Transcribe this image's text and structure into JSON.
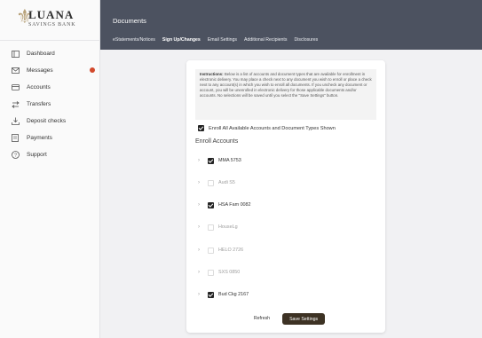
{
  "brand": {
    "name": "LUANA",
    "subtitle": "SAVINGS BANK"
  },
  "sidebar": {
    "items": [
      {
        "label": "Dashboard",
        "icon": "dashboard-icon"
      },
      {
        "label": "Messages",
        "icon": "mail-icon",
        "badge": true
      },
      {
        "label": "Accounts",
        "icon": "card-icon"
      },
      {
        "label": "Transfers",
        "icon": "transfer-icon"
      },
      {
        "label": "Deposit checks",
        "icon": "deposit-icon"
      },
      {
        "label": "Payments",
        "icon": "bill-icon"
      },
      {
        "label": "Support",
        "icon": "support-icon"
      }
    ]
  },
  "header": {
    "title": "Documents",
    "tabs": [
      {
        "label": "eStatements/Notices",
        "active": false
      },
      {
        "label": "Sign Up/Changes",
        "active": true
      },
      {
        "label": "Email Settings",
        "active": false
      },
      {
        "label": "Additional Recipients",
        "active": false
      },
      {
        "label": "Disclosures",
        "active": false
      }
    ]
  },
  "instructions": {
    "heading": "Instructions:",
    "text": "Below is a list of accounts and document types that are available for enrollment in electronic delivery. You may place a check next to any document you wish to enroll or place a check next to any account(s) in which you wish to enroll all documents. If you uncheck any document or account, you will be unenrolled in electronic delivery for those applicable documents and/or accounts. No selections will be saved until you select the \"Save Settings\" button."
  },
  "enroll_all": {
    "label": "Enroll All Available Accounts and Document Types Shown",
    "checked": true
  },
  "enroll_section": {
    "title": "Enroll Accounts"
  },
  "accounts": [
    {
      "name": "MMA 5753",
      "checked": true,
      "disabled": false
    },
    {
      "name": "Audi S5",
      "checked": false,
      "disabled": true
    },
    {
      "name": "HSA Fam 0082",
      "checked": true,
      "disabled": false
    },
    {
      "name": "HouseLg",
      "checked": false,
      "disabled": true
    },
    {
      "name": "HELO 2726",
      "checked": false,
      "disabled": true
    },
    {
      "name": "SXS 0850",
      "checked": false,
      "disabled": true
    },
    {
      "name": "Bud Ckg 2167",
      "checked": true,
      "disabled": false
    }
  ],
  "actions": {
    "refresh_label": "Refresh",
    "save_label": "Save Settings"
  },
  "colors": {
    "topbar": "#4c5260",
    "save_button": "#3d3224",
    "badge": "#d2492c",
    "logo_mark": "#b8a27a"
  }
}
